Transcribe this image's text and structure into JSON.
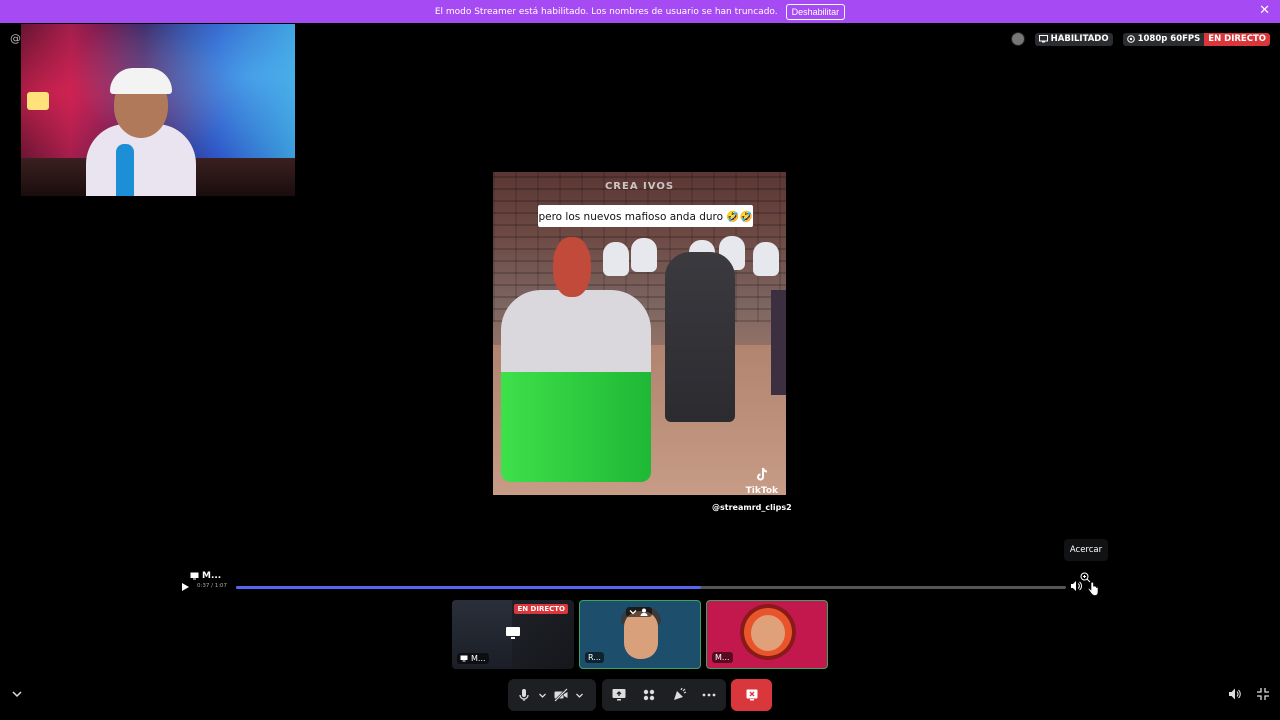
{
  "banner": {
    "message": "El modo Streamer está habilitado. Los nombres de usuario se han truncado.",
    "disable_button": "Deshabilitar"
  },
  "left_marker": "@",
  "status": {
    "habilitado": "HABILITADO",
    "quality": "1080p 60FPS",
    "live": "EN DIRECTO"
  },
  "video": {
    "top_watermark": "CREA IVOS",
    "caption": "pero los nuevos mafioso anda duro 🤣🤣",
    "tiktok_label": "TikTok",
    "tiktok_handle": "@streamrd_clips2"
  },
  "tooltip": "Acercar",
  "player": {
    "owner": "M...",
    "time": "0:37 / 1:07",
    "progress_fraction": 0.56
  },
  "tiles": [
    {
      "name": "M...",
      "badge": "EN DIRECTO"
    },
    {
      "name": "R..."
    },
    {
      "name": "M..."
    }
  ],
  "colors": {
    "banner": "#a64af4",
    "live": "#da373c",
    "accent": "#5865f2",
    "speaking": "#3ba55d"
  }
}
